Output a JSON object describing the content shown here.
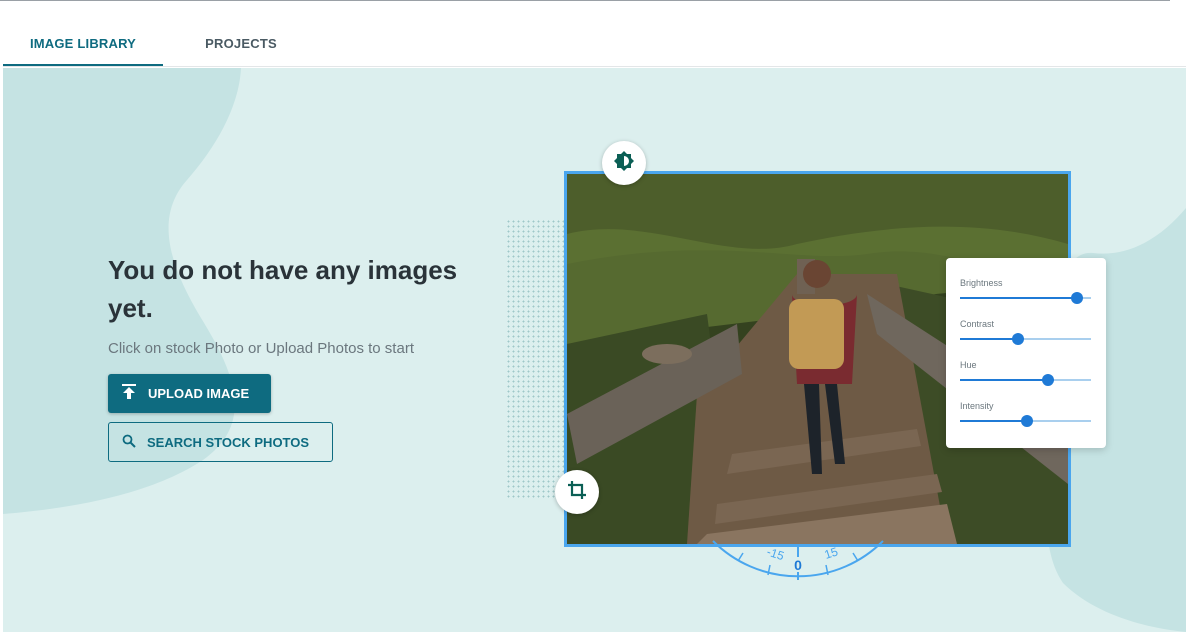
{
  "tabs": [
    {
      "label": "IMAGE LIBRARY",
      "active": true
    },
    {
      "label": "PROJECTS",
      "active": false
    }
  ],
  "empty_state": {
    "headline": "You do not have any images yet.",
    "subline": "Click on stock Photo or Upload Photos to start",
    "upload_button": {
      "label": "UPLOAD IMAGE",
      "icon": "upload-icon"
    },
    "search_button": {
      "label": "SEARCH STOCK PHOTOS",
      "icon": "search-icon"
    }
  },
  "illustration": {
    "top_icon": "contrast-icon",
    "side_icon": "crop-icon",
    "adjustments": [
      {
        "label": "Brightness",
        "level": 0.89
      },
      {
        "label": "Contrast",
        "level": 0.44
      },
      {
        "label": "Hue",
        "level": 0.67
      },
      {
        "label": "Intensity",
        "level": 0.51
      }
    ],
    "rotation_dial": {
      "ticks": [
        "-15",
        "0",
        "15"
      ]
    }
  },
  "colors": {
    "accent": "#0e6b80",
    "background": "#dcefee",
    "blob": "#c5e3e3",
    "frame": "#4aa6ee",
    "slider": "#1f7ad6"
  }
}
